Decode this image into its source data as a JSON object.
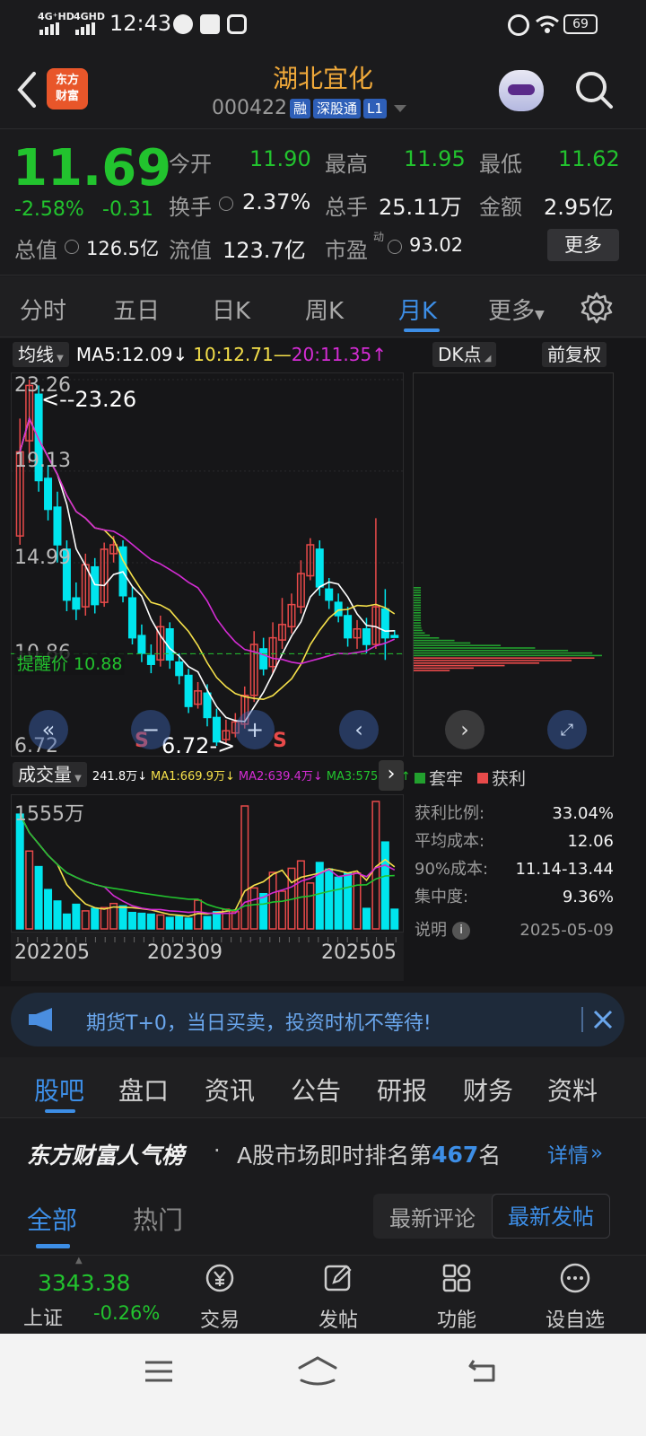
{
  "status": {
    "net1": "4G⁺HD",
    "net2": "4GHD",
    "time": "12:43",
    "battery": "69"
  },
  "header": {
    "logo_line1": "东方",
    "logo_line2": "财富",
    "stock_name": "湖北宜化",
    "stock_code": "000422",
    "tag_rong": "融",
    "tag_sgt": "深股通",
    "tag_l1": "L1"
  },
  "quote": {
    "price": "11.69",
    "change_pct": "-2.58%",
    "change": "-0.31",
    "open_label": "今开",
    "open": "11.90",
    "high_label": "最高",
    "high": "11.95",
    "low_label": "最低",
    "low": "11.62",
    "turnover_label": "换手",
    "turnover": "2.37%",
    "volume_label": "总手",
    "volume": "25.11万",
    "amount_label": "金额",
    "amount": "2.95亿",
    "mktcap_label": "总值",
    "mktcap": "126.5亿",
    "float_label": "流值",
    "float": "123.7亿",
    "pe_label": "市盈",
    "pe_sup": "动",
    "pe": "93.02",
    "more_label": "更多"
  },
  "chart_tabs": [
    "分时",
    "五日",
    "日K",
    "周K",
    "月K",
    "更多"
  ],
  "chart": {
    "ma_label": "均线",
    "ma5": "MA5:12.09↓",
    "ma10": "10:12.71—",
    "ma20": "20:11.35↑",
    "dk_label": "DK点",
    "adjust_label": "前复权",
    "y_top": "23.26",
    "y2": "19.13",
    "y3": "14.99",
    "y4": "10.86",
    "y_bottom": "6.72",
    "max_marker": "<--23.26",
    "min_marker": "6.72->",
    "alert_label": "提醒价 10.88",
    "sell_marker": "S",
    "vol_label": "成交量",
    "vol_value": "241.8万↓",
    "vol_ma1": "MA1:669.9万↓",
    "vol_ma2": "MA2:639.4万↓",
    "vol_ma3": "MA3:575.1万↑",
    "vol_max": "1555万",
    "x_labels": [
      "202205",
      "202309",
      "202505"
    ],
    "colors": {
      "up": "#e84a4a",
      "down": "#00e5ee",
      "ma5": "#ffffff",
      "ma10": "#f5e04a",
      "ma20": "#d42cd4"
    }
  },
  "chip": {
    "legend_trapped": "套牢",
    "legend_profit": "获利",
    "profit_ratio_label": "获利比例:",
    "profit_ratio": "33.04%",
    "avg_cost_label": "平均成本:",
    "avg_cost": "12.06",
    "cost90_label": "90%成本:",
    "cost90": "11.14-13.44",
    "concentration_label": "集中度:",
    "concentration": "9.36%",
    "note_label": "说明",
    "date": "2025-05-09"
  },
  "ad": {
    "text": "期货T+0，当日买卖，投资时机不等待!"
  },
  "bottom_tabs": [
    "股吧",
    "盘口",
    "资讯",
    "公告",
    "研报",
    "财务",
    "资料"
  ],
  "rank": {
    "title": "东方财富人气榜",
    "dot": "·",
    "text_prefix": "A股市场即时排名第",
    "rank_num": "467",
    "text_suffix": "名",
    "detail": "详情"
  },
  "filter": {
    "tab_all": "全部",
    "tab_hot": "热门",
    "latest_comment": "最新评论",
    "latest_post": "最新发帖"
  },
  "nav": {
    "index_value": "3343.38",
    "index_name": "上证",
    "index_change": "-0.26%",
    "trade": "交易",
    "post": "发帖",
    "func": "功能",
    "watch": "设自选"
  }
}
